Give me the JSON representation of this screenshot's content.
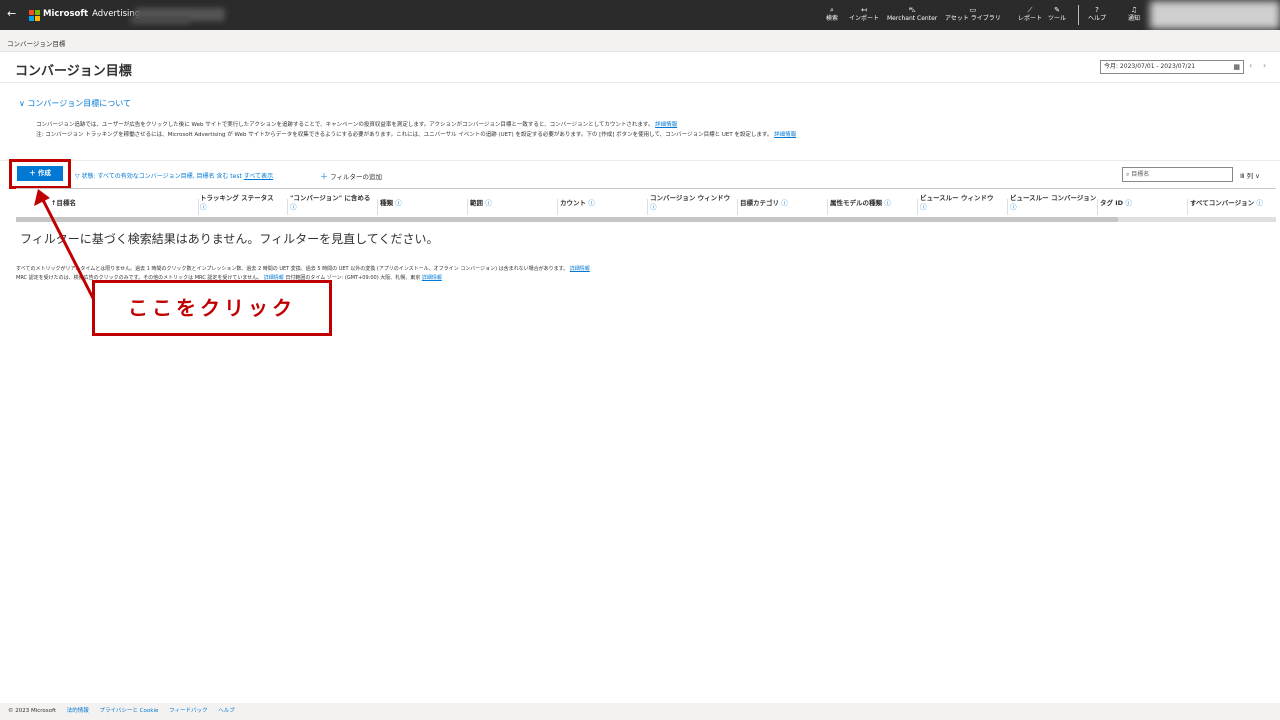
{
  "topbar": {
    "back_icon": "arrow-left-icon",
    "brand_name": "Microsoft",
    "product_name": "Advertising",
    "items": [
      {
        "icon": "search-icon",
        "glyph": "⌕",
        "label": "検索"
      },
      {
        "icon": "import-icon",
        "glyph": "↤",
        "label": "インポート"
      },
      {
        "icon": "cart-icon",
        "glyph": "⛍",
        "label": "Merchant Center"
      },
      {
        "icon": "library-icon",
        "glyph": "▭",
        "label": "アセット ライブラリ"
      },
      {
        "icon": "chart-icon",
        "glyph": "⟋",
        "label": "レポート"
      },
      {
        "icon": "wrench-icon",
        "glyph": "✎",
        "label": "ツール"
      },
      {
        "icon": "help-icon",
        "glyph": "?",
        "label": "ヘルプ"
      },
      {
        "icon": "bell-icon",
        "glyph": "♫",
        "label": "通知"
      }
    ]
  },
  "breadcrumb": "コンバージョン目標",
  "page_title": "コンバージョン目標",
  "date_range": "今月: 2023/07/01 - 2023/07/21",
  "about": {
    "toggle": "∨ コンバージョン目標について",
    "line1": "コンバージョン追跡では、ユーザーが広告をクリックした後に Web サイトで実行したアクションを追跡することで、キャンペーンの投資収益率を測定します。アクションがコンバージョン目標と一致すると、コンバージョンとしてカウントされます。",
    "line1_link": "詳細情報",
    "line2": "注: コンバージョン トラッキングを稼働させるには、Microsoft Advertising が Web サイトからデータを収集できるようにする必要があります。これには、ユニバーサル イベントの追跡 (UET) を設定する必要があります。下の [作成] ボタンを使用して、コンバージョン目標と UET を設定します。",
    "line2_link": "詳細情報"
  },
  "toolbar": {
    "create_label": "＋ 作成",
    "filter_text": "状態: すべての有効なコンバージョン目標, 目標名 含む test",
    "show_all": "すべて表示",
    "add_filter": "フィルターの追加",
    "search_placeholder": "目標名",
    "columns_label": "列"
  },
  "table": {
    "columns": [
      "目標名",
      "トラッキング ステータス",
      "\"コンバージョン\" に含める",
      "種類",
      "範囲",
      "カウント",
      "コンバージョン ウィンドウ",
      "目標カテゴリ",
      "属性モデルの種類",
      "ビュースルー ウィンドウ",
      "ビュースルー コンバージョン",
      "タグ ID",
      "すべてコンバージョン"
    ],
    "empty_message": "フィルターに基づく検索結果はありません。フィルターを見直してください。"
  },
  "notes": {
    "line1": "すべてのメトリックがリアルタイムとは限りません。過去 1 時間のクリック数とインプレッション数、過去 2 時間の UET 変換、過去 5 時間の UET 以外の変換 (アプリのインストール、オフライン コンバージョン) は含まれない場合があります。",
    "line1_link": "詳細情報",
    "line2": "MRC 認定を受けたのは、検索広告のクリックのみです。その他のメトリックは MRC 認定を受けていません。",
    "line2_link1": "詳細情報",
    "line2_mid": "日付範囲のタイム ゾーン: (GMT+09:00) 大阪、札幌、東京",
    "line2_link2": "詳細情報"
  },
  "callout": "ここをクリック",
  "footer": {
    "copyright": "© 2023 Microsoft",
    "links": [
      "法的情報",
      "プライバシーと Cookie",
      "フィードバック",
      "ヘルプ"
    ]
  },
  "colors": {
    "accent": "#0078d4",
    "highlight": "#c00000",
    "topbar": "#2b2b2b"
  }
}
